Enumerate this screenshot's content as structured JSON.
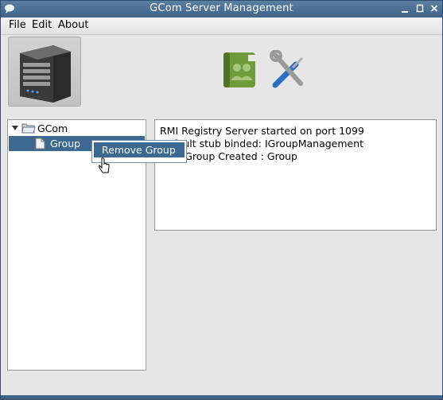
{
  "window": {
    "title": "GCom Server Management"
  },
  "menubar": {
    "items": [
      "File",
      "Edit",
      "About"
    ]
  },
  "toolbar": {
    "server_icon": "server-tower-icon",
    "group_icon": "group-book-icon",
    "tools_icon": "wrench-screwdriver-icon"
  },
  "tree": {
    "root": {
      "label": "GCom",
      "expanded": true
    },
    "children": [
      {
        "label": "Group",
        "selected": true
      }
    ]
  },
  "context_menu": {
    "items": [
      "Remove Group"
    ]
  },
  "log": {
    "lines": [
      "RMI Registry Server started on port 1099",
      "Default stub binded: IGroupManagement",
      "New Group Created : Group"
    ]
  },
  "colors": {
    "titlebar": "#3f6487",
    "selection": "#3d6890",
    "accent_green": "#6f9b3a"
  }
}
